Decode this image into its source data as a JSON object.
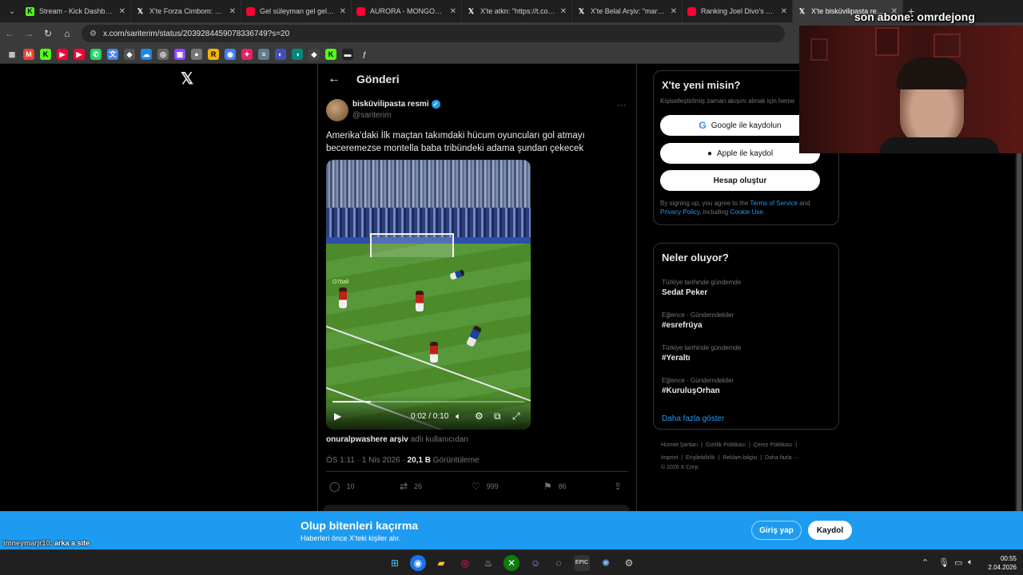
{
  "browser": {
    "tabs": [
      {
        "title": "Stream - Kick Dashboard",
        "icon": "kick-icon",
        "active": false
      },
      {
        "title": "X'te Forza Cimbom: \"Tam",
        "icon": "x-icon",
        "active": false
      },
      {
        "title": "Gel süleyman gel gel amm",
        "icon": "youtube-icon",
        "active": false
      },
      {
        "title": "AURORA - MONGOLZ Ma",
        "icon": "youtube-icon",
        "active": false
      },
      {
        "title": "X'te atkn: \"https://t.co/esl",
        "icon": "x-icon",
        "active": false
      },
      {
        "title": "X'te Belal Arşiv: \"marco re",
        "icon": "x-icon",
        "active": false
      },
      {
        "title": "Ranking Joel Divo's Top 5",
        "icon": "youtube-icon",
        "active": false
      },
      {
        "title": "X'te bisküvilipasta resmi:",
        "icon": "x-icon",
        "active": true
      }
    ],
    "url": "x.com/sariterim/status/2039284459078336749?s=20"
  },
  "page": {
    "title": "Gönderi"
  },
  "post": {
    "author_name": "bisküvilipasta resmi",
    "author_handle": "@sariterim",
    "text_line1": "Amerika'daki İlk maçtan takımdaki hücum oyuncuları gol atmayı",
    "text_line2": "beceremezse montella baba tribündeki adama şundan çekecek",
    "video": {
      "watermark": "O7ball",
      "time": "0:02 / 0:10",
      "progress": 0.2
    },
    "attribution_user": "onuralpwashere arşiv",
    "attribution_suffix": "adlı kullanıcıdan",
    "timestamp": "ÖS 1:11 · 1 Nis 2026 ·",
    "views": "20,1 B",
    "views_label": "Görüntüleme",
    "replies": "10",
    "reposts": "26",
    "likes": "999",
    "bookmarks": "86"
  },
  "signup": {
    "heading": "X'te yeni misin?",
    "subtitle": "Kişiselleştirilmiş zaman akışını almak için heme",
    "google_label": "Google ile kaydolun",
    "apple_label": "Apple ile kaydol",
    "create_label": "Hesap oluştur",
    "terms_pre": "By signing up, you agree to the",
    "terms_tos": "Terms of Service",
    "terms_and": "and",
    "terms_privacy": "Privacy Policy",
    "terms_including": ", including",
    "terms_cookie": "Cookie Use."
  },
  "trends": {
    "heading": "Neler oluyor?",
    "items": [
      {
        "category": "Türkiye tarihinde gündemde",
        "name": "Sedat Peker"
      },
      {
        "category": "Eğlence · Gündemdekiler",
        "name": "#esrefrüya"
      },
      {
        "category": "Türkiye tarihinde gündemde",
        "name": "#Yeraltı"
      },
      {
        "category": "Eğlence · Gündemdekiler",
        "name": "#KuruluşOrhan"
      }
    ],
    "show_more": "Daha fazla göster"
  },
  "footer": {
    "links": [
      "Hizmet Şartları",
      "Gizlilik Politikası",
      "Çerez Politikası",
      "Imprint",
      "Erişilebilirlik",
      "Reklam bilgisi",
      "Daha fazla ···"
    ],
    "copyright": "© 2026 X Corp."
  },
  "banner": {
    "heading": "Olup bitenleri kaçırma",
    "subtitle": "Haberleri önce X'teki kişiler alır.",
    "login": "Giriş yap",
    "register": "Kaydol"
  },
  "stream_overlay": {
    "text": "son abone: omrdejong",
    "chat_user": "imneymarjr10",
    "chat_text": ": arka a site"
  },
  "taskbar": {
    "time": "00:55",
    "date": "2.04.2026"
  },
  "colors": {
    "accent": "#1d9bf0",
    "background": "#000000",
    "muted": "#71767b"
  }
}
